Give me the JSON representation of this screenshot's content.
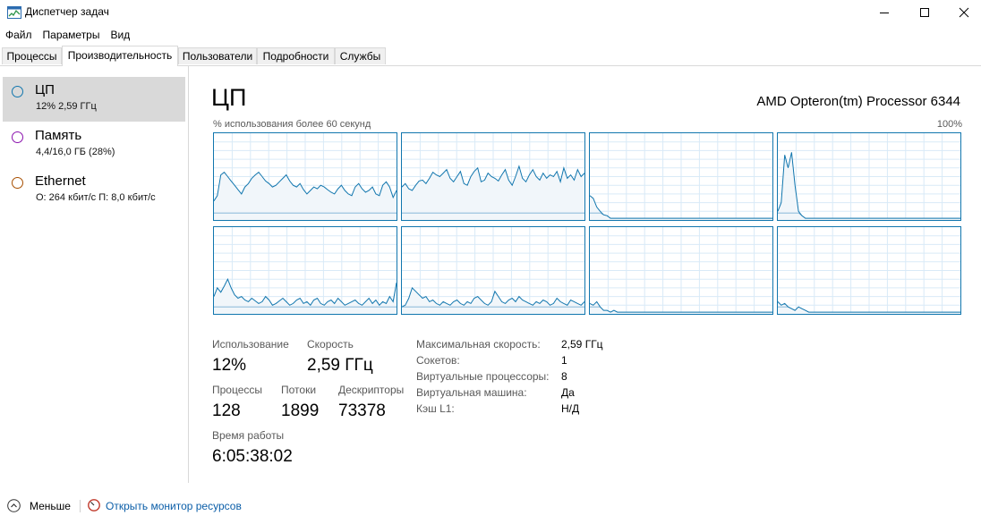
{
  "window": {
    "title": "Диспетчер задач"
  },
  "menu": [
    "Файл",
    "Параметры",
    "Вид"
  ],
  "tabs": [
    "Процессы",
    "Производительность",
    "Пользователи",
    "Подробности",
    "Службы"
  ],
  "sidebar": [
    {
      "name": "ЦП",
      "sub": "12%  2,59 ГГц",
      "color": "#1176ae",
      "active": true
    },
    {
      "name": "Память",
      "sub": "4,4/16,0 ГБ (28%)",
      "color": "#8b12ae",
      "active": false
    },
    {
      "name": "Ethernet",
      "sub": "О: 264 кбит/с  П: 8,0 кбит/с",
      "color": "#a74f01",
      "active": false
    }
  ],
  "main": {
    "title": "ЦП",
    "processor": "AMD Opteron(tm) Processor 6344",
    "graph_caption": "% использования более 60 секунд",
    "graph_max": "100%",
    "graph_color": "#1176ae"
  },
  "stats": {
    "usage_label": "Использование",
    "usage": "12%",
    "speed_label": "Скорость",
    "speed": "2,59 ГГц",
    "processes_label": "Процессы",
    "processes": "128",
    "threads_label": "Потоки",
    "threads": "1899",
    "handles_label": "Дескрипторы",
    "handles": "73378",
    "uptime_label": "Время работы",
    "uptime": "6:05:38:02"
  },
  "details": [
    {
      "label": "Максимальная скорость:",
      "value": "2,59 ГГц"
    },
    {
      "label": "Сокетов:",
      "value": "1"
    },
    {
      "label": "Виртуальные процессоры:",
      "value": "8"
    },
    {
      "label": "Виртуальная машина:",
      "value": "Да"
    },
    {
      "label": "Кэш L1:",
      "value": "Н/Д"
    }
  ],
  "footer": {
    "less": "Меньше",
    "monitor": "Открыть монитор ресурсов"
  },
  "cores": [
    [
      22,
      28,
      52,
      55,
      50,
      45,
      40,
      35,
      30,
      38,
      42,
      48,
      52,
      55,
      50,
      45,
      42,
      38,
      40,
      44,
      48,
      52,
      45,
      40,
      38,
      42,
      35,
      30,
      34,
      38,
      36,
      40,
      38,
      35,
      32,
      30,
      36,
      40,
      34,
      30,
      28,
      38,
      42,
      36,
      32,
      34,
      38,
      30,
      28,
      40,
      44,
      38,
      26,
      34
    ],
    [
      38,
      42,
      36,
      34,
      40,
      45,
      46,
      42,
      48,
      55,
      52,
      50,
      54,
      58,
      48,
      44,
      50,
      56,
      42,
      40,
      50,
      56,
      60,
      44,
      46,
      54,
      50,
      48,
      45,
      52,
      58,
      46,
      40,
      50,
      62,
      48,
      44,
      52,
      58,
      50,
      46,
      54,
      48,
      52,
      50,
      56,
      44,
      60,
      48,
      52,
      46,
      58,
      50,
      54
    ],
    [
      28,
      25,
      15,
      10,
      6,
      5,
      2,
      2,
      2,
      2,
      2,
      2,
      2,
      2,
      2,
      2,
      2,
      2,
      2,
      2,
      2,
      2,
      2,
      2,
      2,
      2,
      2,
      2,
      2,
      2,
      2,
      2,
      2,
      2,
      2,
      2,
      2,
      2,
      2,
      2,
      2,
      2,
      2,
      2,
      2,
      2,
      2,
      2,
      2,
      2,
      2,
      2,
      2,
      2
    ],
    [
      10,
      20,
      75,
      60,
      78,
      40,
      10,
      5,
      2,
      2,
      2,
      2,
      2,
      2,
      2,
      2,
      2,
      2,
      2,
      2,
      2,
      2,
      2,
      2,
      2,
      2,
      2,
      2,
      2,
      2,
      2,
      2,
      2,
      2,
      2,
      2,
      2,
      2,
      2,
      2,
      2,
      2,
      2,
      2,
      2,
      2,
      2,
      2,
      2,
      2,
      2,
      2,
      2,
      2
    ],
    [
      20,
      30,
      25,
      32,
      40,
      30,
      22,
      18,
      20,
      16,
      14,
      18,
      15,
      12,
      14,
      20,
      16,
      10,
      12,
      15,
      18,
      14,
      10,
      12,
      16,
      18,
      12,
      14,
      10,
      16,
      18,
      12,
      10,
      14,
      16,
      12,
      18,
      14,
      10,
      12,
      14,
      16,
      12,
      10,
      14,
      18,
      12,
      16,
      10,
      14,
      12,
      20,
      14,
      36
    ],
    [
      8,
      10,
      18,
      30,
      26,
      22,
      18,
      20,
      14,
      16,
      12,
      10,
      14,
      12,
      10,
      14,
      16,
      12,
      10,
      14,
      12,
      18,
      20,
      16,
      12,
      10,
      14,
      26,
      20,
      14,
      12,
      16,
      18,
      14,
      20,
      16,
      14,
      12,
      10,
      14,
      12,
      16,
      14,
      10,
      12,
      18,
      14,
      12,
      10,
      16,
      14,
      12,
      10,
      14
    ],
    [
      12,
      10,
      14,
      8,
      4,
      4,
      2,
      4,
      2,
      2,
      2,
      2,
      2,
      2,
      2,
      2,
      2,
      2,
      2,
      2,
      2,
      2,
      2,
      2,
      2,
      2,
      2,
      2,
      2,
      2,
      2,
      2,
      2,
      2,
      2,
      2,
      2,
      2,
      2,
      2,
      2,
      2,
      2,
      2,
      2,
      2,
      2,
      2,
      2,
      2,
      2,
      2,
      2,
      2
    ],
    [
      14,
      10,
      12,
      8,
      6,
      4,
      8,
      6,
      4,
      2,
      2,
      2,
      2,
      2,
      2,
      2,
      2,
      2,
      2,
      2,
      2,
      2,
      2,
      2,
      2,
      2,
      2,
      2,
      2,
      2,
      2,
      2,
      2,
      2,
      2,
      2,
      2,
      2,
      2,
      2,
      2,
      2,
      2,
      2,
      2,
      2,
      2,
      2,
      2,
      2,
      2,
      2,
      2,
      2
    ]
  ]
}
